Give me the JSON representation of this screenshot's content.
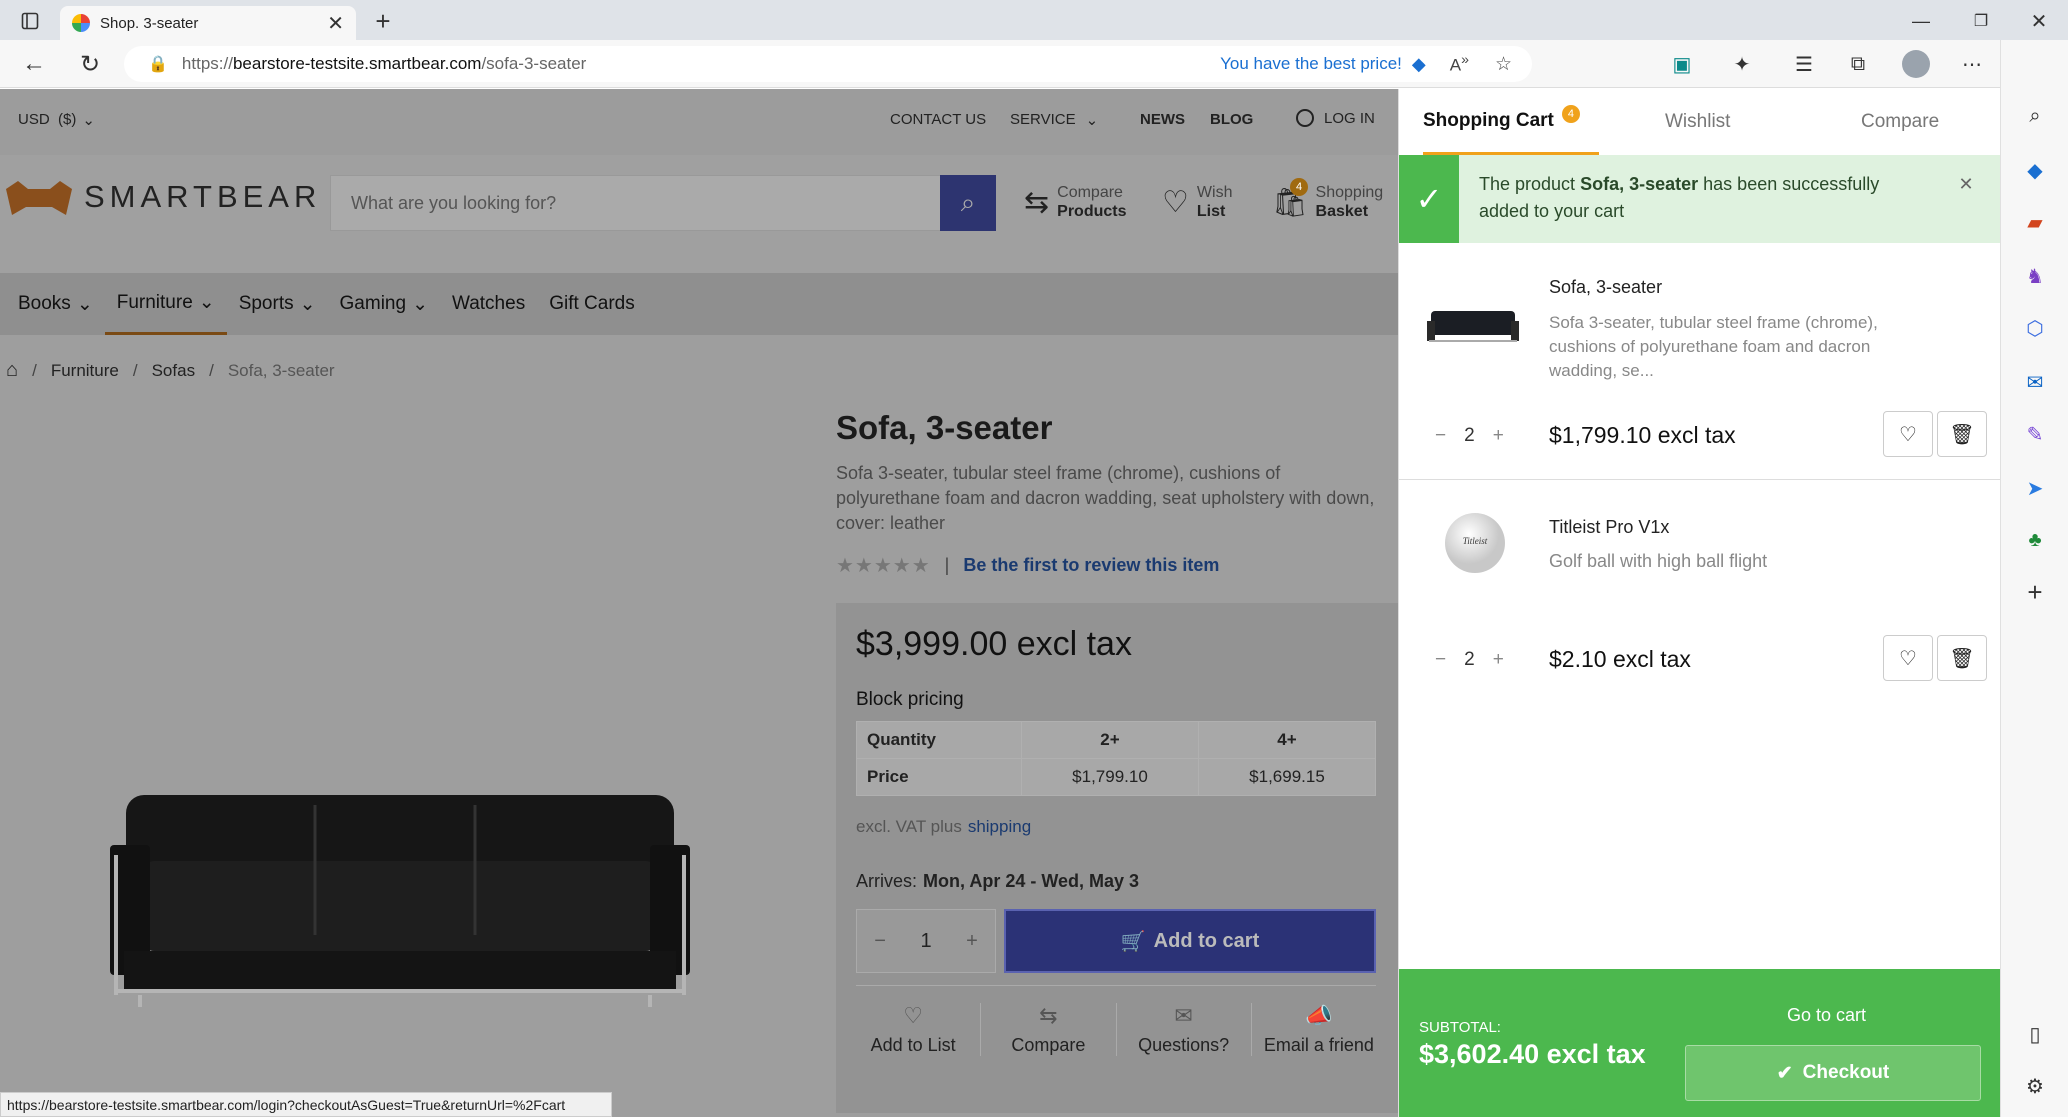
{
  "browser": {
    "tab_title": "Shop. 3-seater",
    "url_prefix": "https://",
    "url_host": "bearstore-testsite.smartbear.com",
    "url_path": "/sofa-3-seater",
    "price_badge": "You have the best price!",
    "status_url": "https://bearstore-testsite.smartbear.com/login?checkoutAsGuest=True&returnUrl=%2Fcart"
  },
  "topbar": {
    "currency": "USD  ($)",
    "contact": "CONTACT US",
    "service": "SERVICE",
    "news": "NEWS",
    "blog": "BLOG",
    "login": "LOG IN"
  },
  "header": {
    "logo_text": "SMARTBEAR",
    "search_placeholder": "What are you looking for?",
    "compare_top": "Compare",
    "compare_bottom": "Products",
    "wish_top": "Wish",
    "wish_bottom": "List",
    "basket_top": "Shopping",
    "basket_bottom": "Basket",
    "basket_count": "4"
  },
  "nav": [
    "Books",
    "Furniture",
    "Sports",
    "Gaming",
    "Watches",
    "Gift Cards"
  ],
  "breadcrumb": {
    "c1": "Furniture",
    "c2": "Sofas",
    "c3": "Sofa, 3-seater"
  },
  "product": {
    "title": "Sofa, 3-seater",
    "desc": "Sofa 3-seater, tubular steel frame (chrome), cushions of polyurethane foam and dacron wadding, seat upholstery with down, cover: leather",
    "review_link": "Be the first to review this item",
    "price": "$3,999.00 excl tax",
    "block_pricing": "Block pricing",
    "table": {
      "q_label": "Quantity",
      "p_label": "Price",
      "q1": "2+",
      "q2": "4+",
      "p1": "$1,799.10",
      "p2": "$1,699.15"
    },
    "vat_text": "excl. VAT plus",
    "shipping_link": "shipping",
    "arrives_label": "Arrives:",
    "arrives_dates": "Mon, Apr 24 - Wed, May 3",
    "qty": "1",
    "add_to_cart": "Add to cart",
    "actions": [
      "Add to List",
      "Compare",
      "Questions?",
      "Email a friend"
    ]
  },
  "cart": {
    "tab_cart": "Shopping Cart",
    "cart_count": "4",
    "tab_wishlist": "Wishlist",
    "tab_compare": "Compare",
    "notice_pre": "The product",
    "notice_product": "Sofa, 3-seater",
    "notice_post": "has been successfully added to your cart",
    "items": [
      {
        "name": "Sofa, 3-seater",
        "desc": "Sofa 3-seater, tubular steel frame (chrome), cushions of polyurethane foam and dacron wadding, se...",
        "qty": "2",
        "price": "$1,799.10 excl tax"
      },
      {
        "name": "Titleist Pro V1x",
        "desc": "Golf ball with high ball flight",
        "qty": "2",
        "price": "$2.10 excl tax"
      }
    ],
    "subtotal_label": "SUBTOTAL:",
    "subtotal": "$3,602.40 excl tax",
    "go_to_cart": "Go to cart",
    "checkout": "Checkout"
  },
  "colors": {
    "accent_green": "#4cb84e",
    "button_blue": "#333b8c",
    "link_blue": "#1a4b8c",
    "badge_orange": "#f0a21b"
  }
}
